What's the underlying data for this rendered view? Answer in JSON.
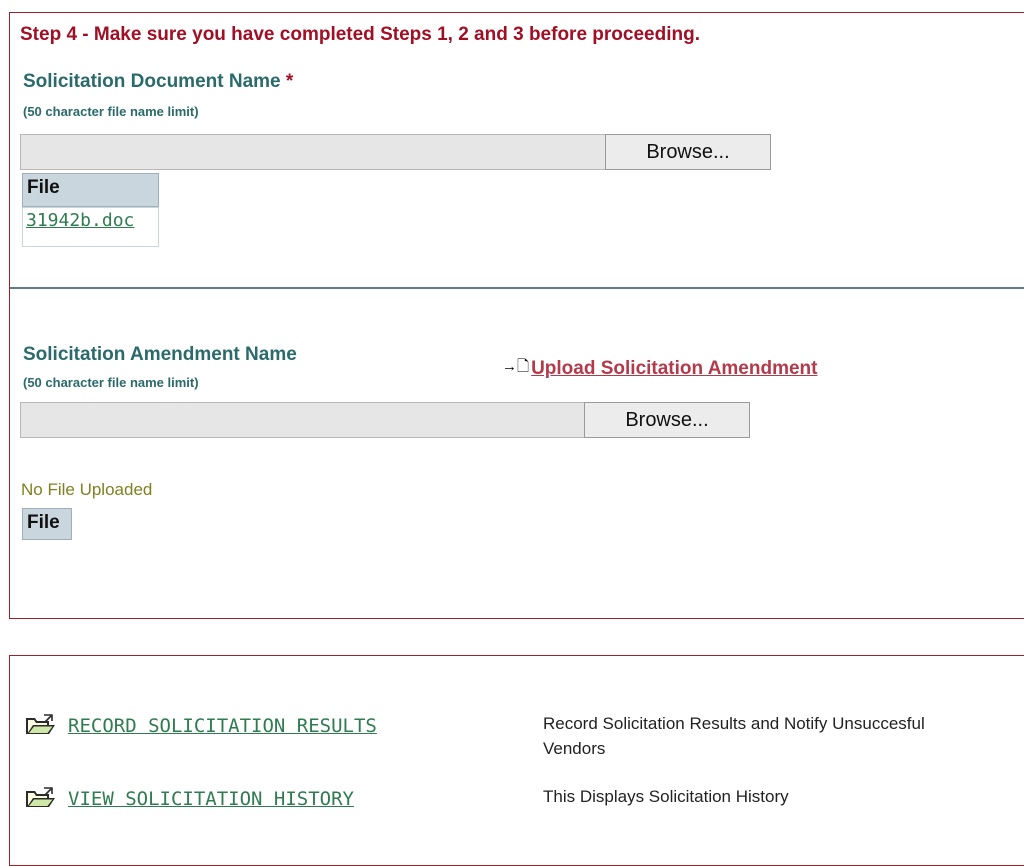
{
  "step4": {
    "title": "Step 4  - Make sure you have completed Steps 1, 2 and 3 before proceeding.",
    "document": {
      "label": "Solicitation Document Name",
      "required_mark": "*",
      "hint": "(50 character file name limit)",
      "browse_label": "Browse...",
      "file_header": "File",
      "file_name": "31942b.doc"
    },
    "amendment": {
      "label": "Solicitation Amendment Name",
      "hint": "(50 character file name limit)",
      "upload_icon": "→🗋",
      "upload_label": "Upload Solicitation Amendment",
      "browse_label": "Browse...",
      "no_file_text": "No File Uploaded",
      "file_header": "File"
    }
  },
  "actions": {
    "items": [
      {
        "icon": "open-folder-icon",
        "label": "RECORD SOLICITATION RESULTS",
        "description": "Record Solicitation Results and Notify Unsuccesful Vendors"
      },
      {
        "icon": "open-folder-icon",
        "label": "VIEW SOLICITATION HISTORY",
        "description": "This Displays Solicitation History"
      }
    ]
  },
  "colors": {
    "panel_border": "#a0202a",
    "step_title": "#a10f25",
    "label_teal": "#2a6a6b",
    "link_green": "#2e7c4f",
    "upload_link": "#b23a4a",
    "no_file": "#808020"
  }
}
